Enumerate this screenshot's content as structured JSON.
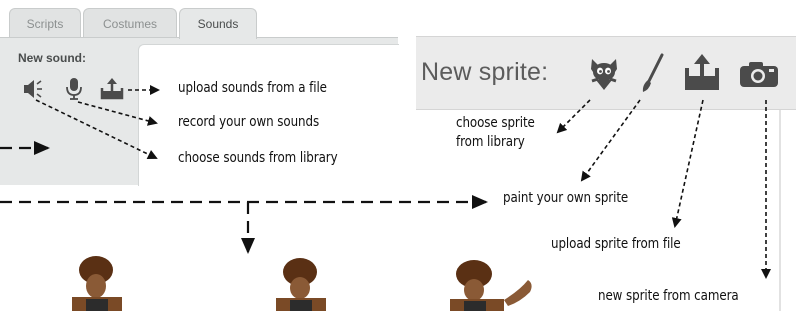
{
  "sounds_panel": {
    "tabs": [
      {
        "label": "Scripts",
        "active": false
      },
      {
        "label": "Costumes",
        "active": false
      },
      {
        "label": "Sounds",
        "active": true
      }
    ],
    "new_sound_label": "New sound:",
    "buttons": [
      {
        "name": "choose-sound-from-library",
        "icon": "speaker-icon"
      },
      {
        "name": "record-sound",
        "icon": "microphone-icon"
      },
      {
        "name": "upload-sound",
        "icon": "upload-icon"
      }
    ]
  },
  "sprite_panel": {
    "title": "New sprite:",
    "buttons": [
      {
        "name": "choose-sprite-from-library",
        "icon": "sprite-library-icon"
      },
      {
        "name": "paint-sprite",
        "icon": "paintbrush-icon"
      },
      {
        "name": "upload-sprite",
        "icon": "upload-icon"
      },
      {
        "name": "sprite-from-camera",
        "icon": "camera-icon"
      }
    ]
  },
  "annotations": {
    "upload_sounds": "upload sounds from a file",
    "record_sounds": "record your own sounds",
    "choose_sounds": "choose sounds from library",
    "choose_sprite_line1": "choose sprite",
    "choose_sprite_line2": "from library",
    "paint_sprite": "paint your own sprite",
    "upload_sprite": "upload sprite from file",
    "camera_sprite": "new sprite from camera"
  },
  "colors": {
    "panel_gray": "#e6e8e8",
    "icon_dark": "#4b4b4b",
    "arrow": "#111111"
  }
}
